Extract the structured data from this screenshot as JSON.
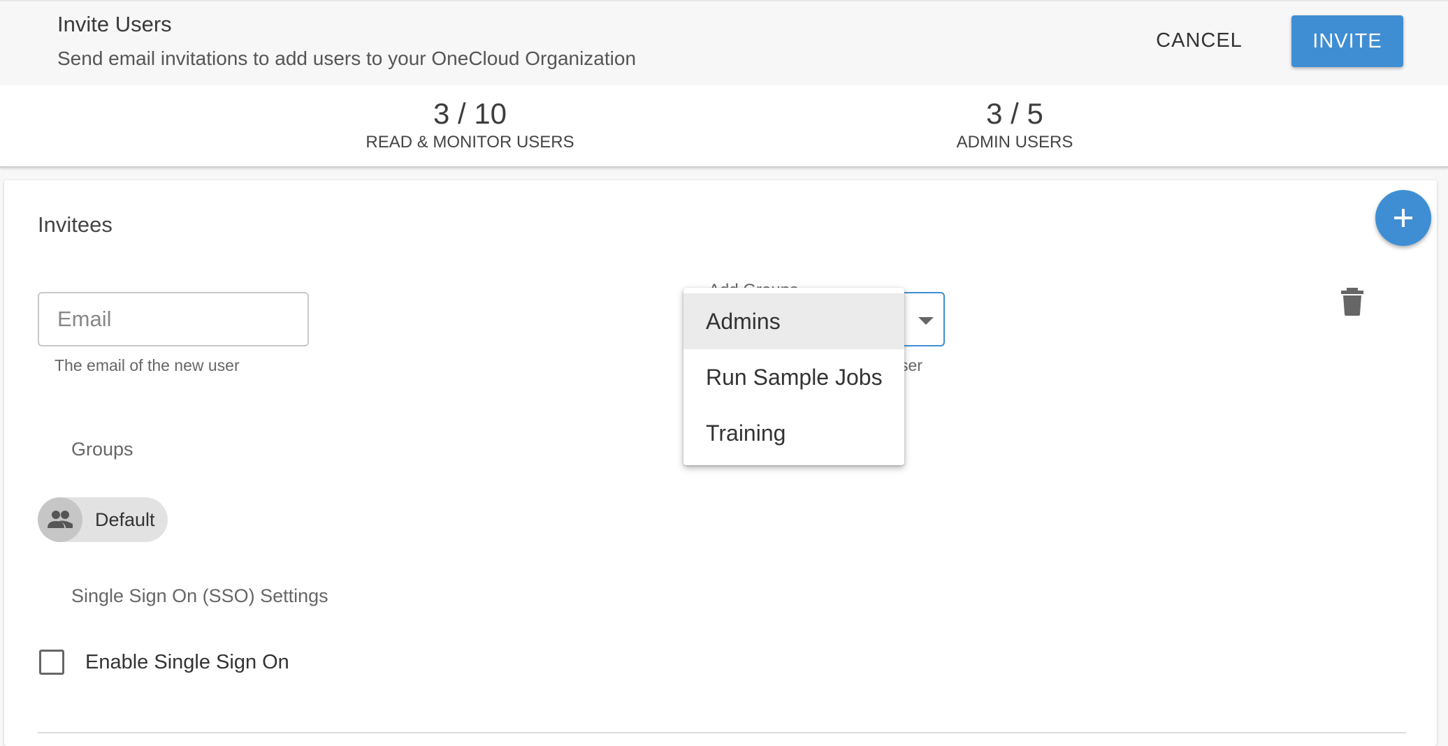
{
  "header": {
    "title": "Invite Users",
    "subtitle": "Send email invitations to add users to your OneCloud Organization",
    "cancel_label": "CANCEL",
    "invite_label": "INVITE"
  },
  "stats": [
    {
      "value": "3 / 10",
      "label": "READ & MONITOR USERS"
    },
    {
      "value": "3 / 5",
      "label": "ADMIN USERS"
    }
  ],
  "invitees": {
    "title": "Invitees",
    "email": {
      "placeholder": "Email",
      "help": "The email of the new user"
    },
    "select": {
      "label": "Add Groups",
      "help_partial": "ser"
    },
    "groups_label": "Groups",
    "groups": [
      {
        "label": "Default"
      }
    ],
    "sso_label": "Single Sign On (SSO) Settings",
    "sso_checkbox_label": "Enable Single Sign On"
  },
  "dropdown": {
    "options": [
      {
        "label": "Admins",
        "selected": true
      },
      {
        "label": "Run Sample Jobs",
        "selected": false
      },
      {
        "label": "Training",
        "selected": false
      }
    ]
  },
  "colors": {
    "accent": "#3f8ed3"
  }
}
